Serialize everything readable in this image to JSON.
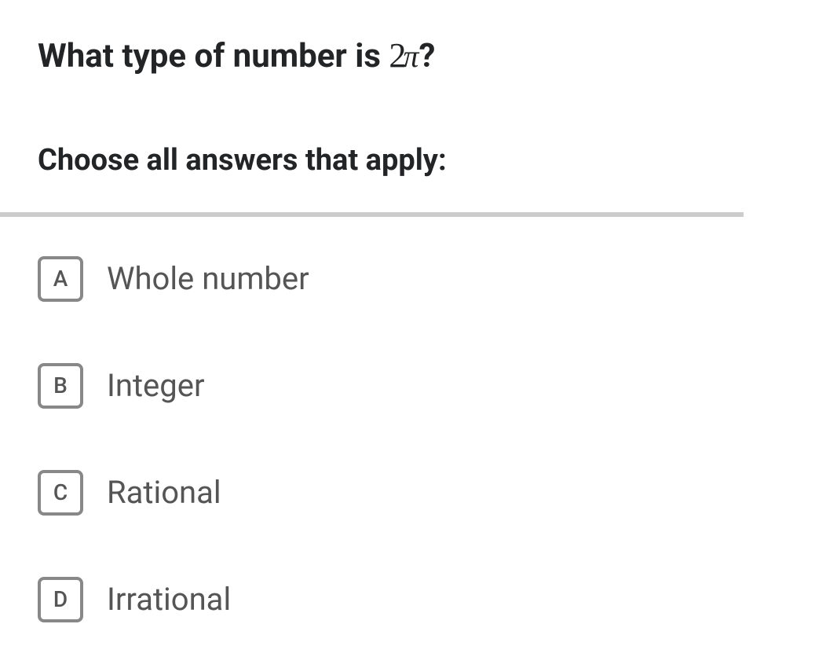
{
  "question": {
    "prefix": "What type of number is ",
    "math_num": "2",
    "math_pi": "π",
    "suffix": "?"
  },
  "instruction": "Choose all answers that apply:",
  "options": [
    {
      "letter": "A",
      "text": "Whole number"
    },
    {
      "letter": "B",
      "text": "Integer"
    },
    {
      "letter": "C",
      "text": "Rational"
    },
    {
      "letter": "D",
      "text": "Irrational"
    }
  ]
}
